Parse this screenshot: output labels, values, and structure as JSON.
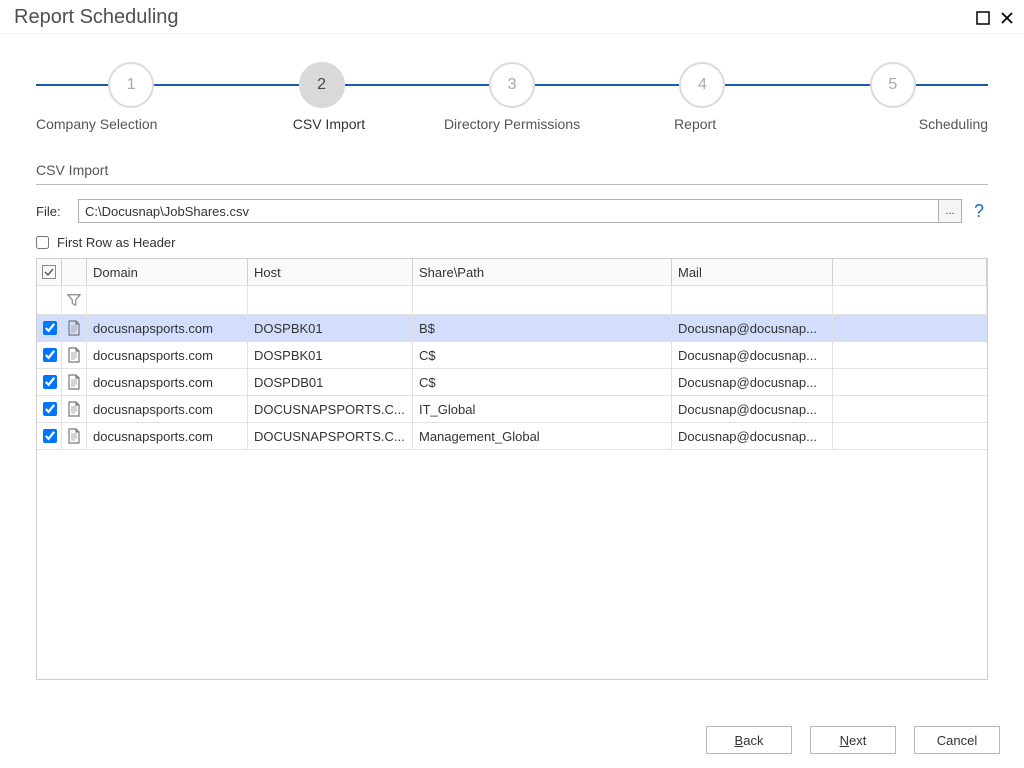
{
  "title": "Report Scheduling",
  "steps": [
    {
      "num": "1",
      "label": "Company Selection"
    },
    {
      "num": "2",
      "label": "CSV Import"
    },
    {
      "num": "3",
      "label": "Directory Permissions"
    },
    {
      "num": "4",
      "label": "Report"
    },
    {
      "num": "5",
      "label": "Scheduling"
    }
  ],
  "active_step_index": 1,
  "section_heading": "CSV Import",
  "file_label": "File:",
  "file_value": "C:\\Docusnap\\JobShares.csv",
  "browse_glyph": "...",
  "help_glyph": "?",
  "first_row_header_label": "First Row as Header",
  "first_row_header_checked": false,
  "columns": {
    "domain": "Domain",
    "host": "Host",
    "share": "Share\\Path",
    "mail": "Mail"
  },
  "rows": [
    {
      "checked": true,
      "domain": "docusnapsports.com",
      "host": "DOSPBK01",
      "share": "B$",
      "mail": "Docusnap@docusnap...",
      "selected": true
    },
    {
      "checked": true,
      "domain": "docusnapsports.com",
      "host": "DOSPBK01",
      "share": "C$",
      "mail": "Docusnap@docusnap...",
      "selected": false
    },
    {
      "checked": true,
      "domain": "docusnapsports.com",
      "host": "DOSPDB01",
      "share": "C$",
      "mail": "Docusnap@docusnap...",
      "selected": false
    },
    {
      "checked": true,
      "domain": "docusnapsports.com",
      "host": "DOCUSNAPSPORTS.C...",
      "share": "IT_Global",
      "mail": "Docusnap@docusnap...",
      "selected": false
    },
    {
      "checked": true,
      "domain": "docusnapsports.com",
      "host": "DOCUSNAPSPORTS.C...",
      "share": "Management_Global",
      "mail": "Docusnap@docusnap...",
      "selected": false
    }
  ],
  "buttons": {
    "back_prefix": "B",
    "back_rest": "ack",
    "next_prefix": "N",
    "next_rest": "ext",
    "cancel": "Cancel"
  }
}
